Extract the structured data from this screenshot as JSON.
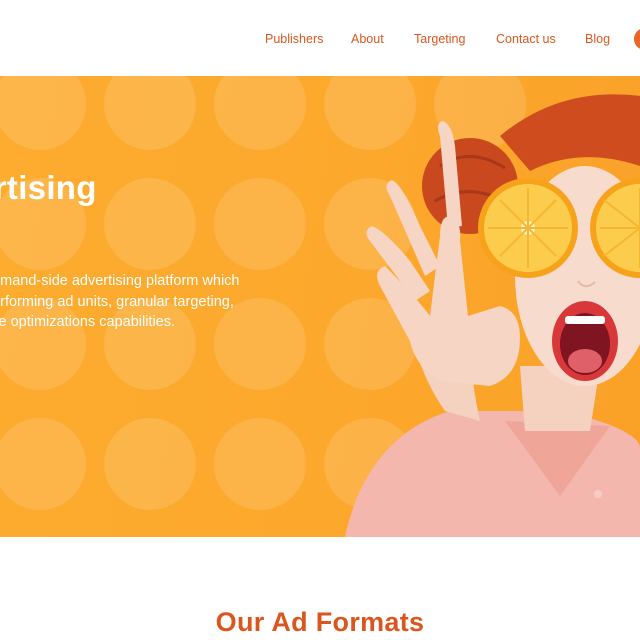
{
  "nav": {
    "items": [
      {
        "label": "Publishers"
      },
      {
        "label": "About"
      },
      {
        "label": "Targeting"
      },
      {
        "label": "Contact us"
      },
      {
        "label": "Blog"
      }
    ]
  },
  "hero": {
    "title": "dvertising",
    "description_lines": [
      "demand-side advertising platform which",
      "performing ad units, granular targeting,",
      "iple optimizations capabilities."
    ],
    "image": "woman-holding-orange-slices-over-eyes"
  },
  "section": {
    "title": "Our Ad Formats"
  },
  "colors": {
    "accent": "#d9571f",
    "hero_background": "#fca82c",
    "cta": "#e8662a"
  }
}
